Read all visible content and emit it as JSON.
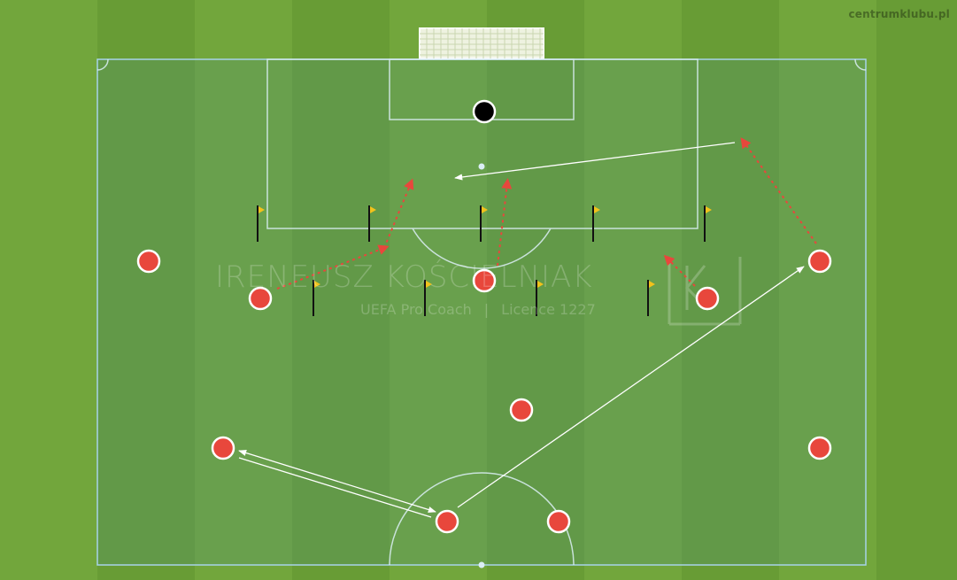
{
  "site_label": "centrumklubu.pl",
  "watermark": {
    "name": "IRENEUSZ KOŚCIELNIAK",
    "role": "UEFA Pro Coach",
    "separator": "|",
    "licence": "Licence 1227",
    "logo_letters": "IK"
  },
  "colors": {
    "grass_light": "#6ea33a",
    "grass_dark": "#5f932e",
    "player_fill": "#e8473c",
    "goalkeeper_fill": "#000000",
    "pass_line": "#ffffff",
    "run_line": "#e8473c",
    "flag": "#f2c21b",
    "lines": "#d9ecf4"
  },
  "icons": {
    "player": "red-circle",
    "goalkeeper": "black-circle",
    "ball": "white-dot",
    "marker": "flag-pole"
  }
}
